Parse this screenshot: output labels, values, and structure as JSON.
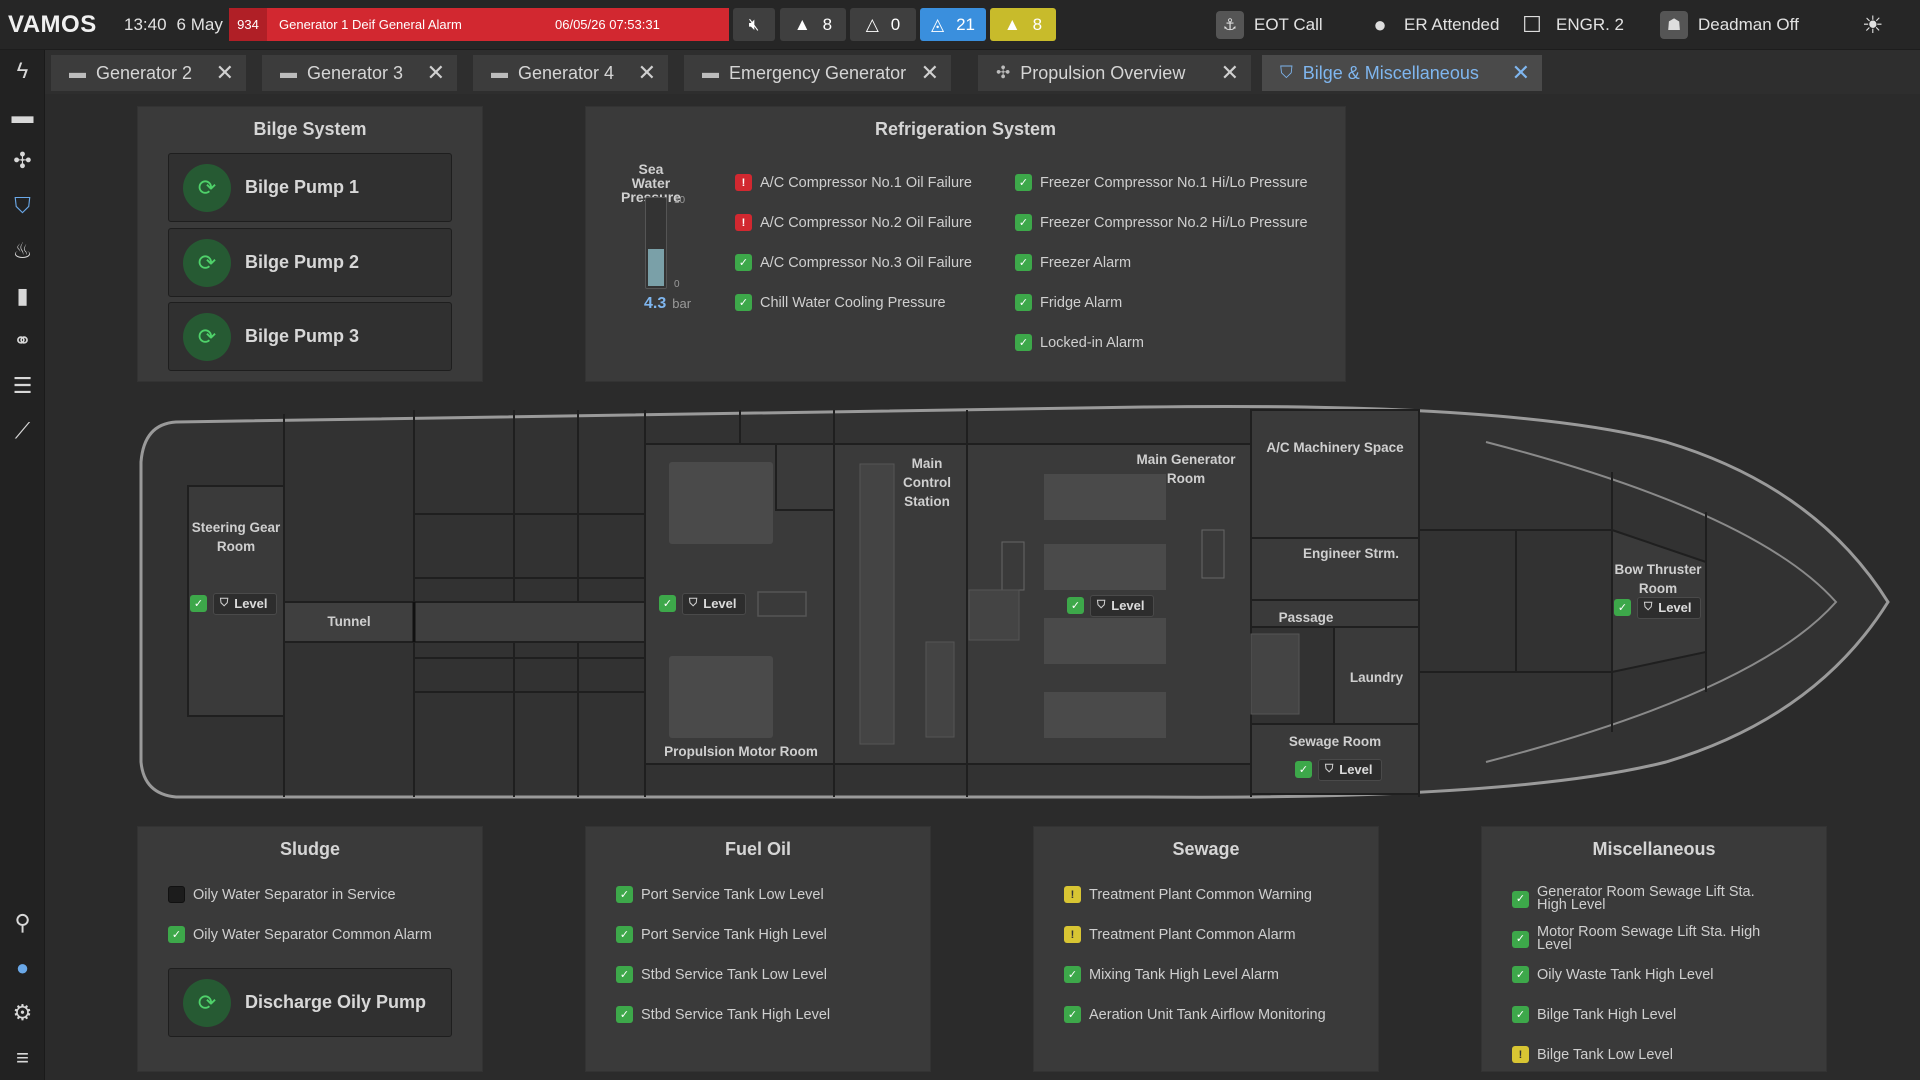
{
  "topbar": {
    "logo": "VAMOS",
    "time": "13:40",
    "date": "6 May",
    "alarm": {
      "id": "934",
      "text": "Generator 1 Deif General Alarm",
      "timestamp": "06/05/26 07:53:31"
    },
    "counters": [
      {
        "name": "alarms",
        "value": "8",
        "color": "#3f3f3f"
      },
      {
        "name": "warnings",
        "value": "0",
        "color": "#3f3f3f"
      },
      {
        "name": "acknowledged",
        "value": "21",
        "color": "#3a8fdd"
      },
      {
        "name": "warning-active",
        "value": "8",
        "color": "#c8bb2b"
      }
    ],
    "eot_call": "EOT Call",
    "er_attended": "ER Attended",
    "engineer": "ENGR. 2",
    "deadman": "Deadman Off"
  },
  "tabs": [
    {
      "label": "Generator 2",
      "icon": "engine-icon"
    },
    {
      "label": "Generator 3",
      "icon": "engine-icon"
    },
    {
      "label": "Generator 4",
      "icon": "engine-icon"
    },
    {
      "label": "Emergency Generator",
      "icon": "engine-icon"
    },
    {
      "label": "Propulsion Overview",
      "icon": "propeller-icon"
    },
    {
      "label": "Bilge & Miscellaneous",
      "icon": "bilge-icon",
      "active": true
    }
  ],
  "bilge": {
    "title": "Bilge System",
    "pumps": [
      "Bilge Pump 1",
      "Bilge Pump 2",
      "Bilge Pump 3"
    ]
  },
  "refrigeration": {
    "title": "Refrigeration System",
    "gauge": {
      "label": "Sea Water Pressure",
      "value": "4.3",
      "unit": "bar",
      "max": "10",
      "min": "0",
      "fill_fraction": 0.43
    },
    "left": [
      {
        "label": "A/C Compressor No.1 Oil Failure",
        "status": "alarm"
      },
      {
        "label": "A/C Compressor No.2 Oil Failure",
        "status": "alarm"
      },
      {
        "label": "A/C Compressor No.3 Oil Failure",
        "status": "ok"
      },
      {
        "label": "Chill Water Cooling Pressure",
        "status": "ok"
      }
    ],
    "right": [
      {
        "label": "Freezer Compressor No.1 Hi/Lo Pressure",
        "status": "ok"
      },
      {
        "label": "Freezer Compressor No.2 Hi/Lo Pressure",
        "status": "ok"
      },
      {
        "label": "Freezer Alarm",
        "status": "ok"
      },
      {
        "label": "Fridge Alarm",
        "status": "ok"
      },
      {
        "label": "Locked-in Alarm",
        "status": "ok"
      }
    ]
  },
  "ship": {
    "rooms": {
      "steering": "Steering Gear Room",
      "tunnel": "Tunnel",
      "propulsion": "Propulsion Motor Room",
      "control": "Main Control Station",
      "main_gen": "Main Generator Room",
      "ac": "A/C Machinery Space",
      "engineer": "Engineer Strm.",
      "passage": "Passage",
      "laundry": "Laundry",
      "sewage": "Sewage Room",
      "bow": "Bow Thruster Room"
    },
    "level_label": "Level"
  },
  "sludge": {
    "title": "Sludge",
    "items": [
      {
        "label": "Oily Water Separator in Service",
        "status": "off"
      },
      {
        "label": "Oily Water Separator Common Alarm",
        "status": "ok"
      }
    ],
    "pump": "Discharge Oily Pump"
  },
  "fuel": {
    "title": "Fuel Oil",
    "items": [
      {
        "label": "Port Service Tank Low Level",
        "status": "ok"
      },
      {
        "label": "Port Service Tank High Level",
        "status": "ok"
      },
      {
        "label": "Stbd Service Tank Low Level",
        "status": "ok"
      },
      {
        "label": "Stbd Service Tank High Level",
        "status": "ok"
      }
    ]
  },
  "sewage": {
    "title": "Sewage",
    "items": [
      {
        "label": "Treatment Plant Common Warning",
        "status": "warn"
      },
      {
        "label": "Treatment Plant Common Alarm",
        "status": "warn"
      },
      {
        "label": "Mixing Tank High Level Alarm",
        "status": "ok"
      },
      {
        "label": "Aeration Unit Tank Airflow Monitoring",
        "status": "ok"
      }
    ]
  },
  "misc": {
    "title": "Miscellaneous",
    "items": [
      {
        "label": "Generator Room Sewage Lift Sta. High Level",
        "status": "ok"
      },
      {
        "label": "Motor Room Sewage Lift Sta. High Level",
        "status": "ok"
      },
      {
        "label": "Oily Waste Tank High Level",
        "status": "ok"
      },
      {
        "label": "Bilge Tank High Level",
        "status": "ok"
      },
      {
        "label": "Bilge Tank Low Level",
        "status": "warn"
      }
    ]
  }
}
